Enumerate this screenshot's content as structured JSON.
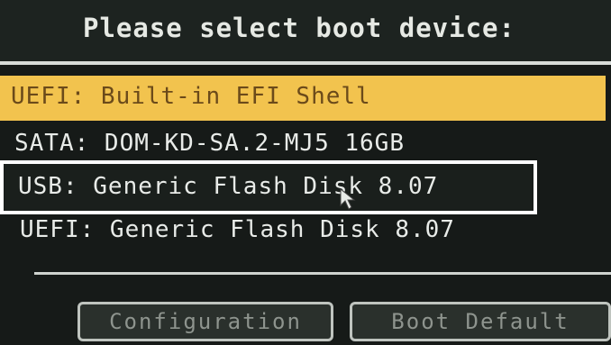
{
  "header": {
    "title": "Please select boot device:"
  },
  "boot_menu": {
    "items": [
      {
        "label": "UEFI: Built-in EFI Shell",
        "state": "highlighted"
      },
      {
        "label": "SATA: DOM-KD-SA.2-MJ5 16GB",
        "state": "normal"
      },
      {
        "label": "USB: Generic Flash Disk 8.07",
        "state": "outlined"
      },
      {
        "label": "UEFI: Generic Flash Disk 8.07",
        "state": "normal"
      }
    ]
  },
  "buttons": {
    "configuration": "Configuration",
    "boot_default": "Boot Default"
  },
  "colors": {
    "background": "#161a18",
    "highlight": "#f2c34e",
    "highlight_text": "#6b4a1a",
    "text": "#e8ebe8",
    "outline": "#ffffff"
  }
}
